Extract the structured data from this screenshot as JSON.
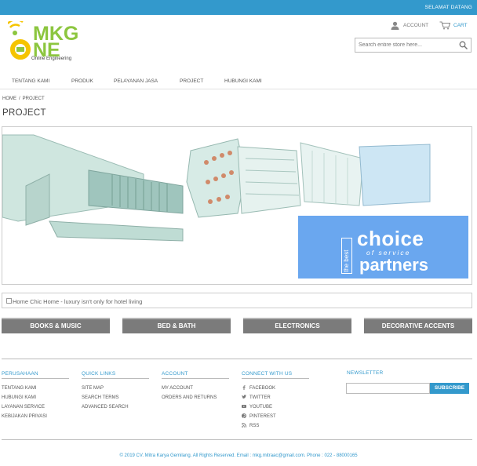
{
  "topbar": {
    "welcome": "SELAMAT DATANG"
  },
  "logo": {
    "line1": "MKG",
    "line2": "NE",
    "tagline": "Online Engineering"
  },
  "header": {
    "account_label": "ACCOUNT",
    "cart_label": "CART",
    "search_placeholder": "Search entire store here..."
  },
  "nav": {
    "items": [
      "TENTANG KAMI",
      "PRODUK",
      "PELAYANAN JASA",
      "PROJECT",
      "HUBUNGI KAMI"
    ]
  },
  "breadcrumb": {
    "home": "HOME",
    "separator": "/",
    "current": "PROJECT"
  },
  "page_title": "PROJECT",
  "banner": {
    "vertical_text": "the best",
    "headline_1": "choice",
    "subline": "of service",
    "headline_2": "partners"
  },
  "alt_image_text": "Home Chic Home - luxury isn't only for hotel living",
  "categories": [
    "BOOKS & MUSIC",
    "BED & BATH",
    "ELECTRONICS",
    "DECORATIVE ACCENTS"
  ],
  "footer": {
    "perusahaan": {
      "title": "PERUSAHAAN",
      "links": [
        "TENTANG KAMI",
        "HUBUNGI KAMI",
        "LAYANAN SERVICE",
        "KEBIJAKAN PRIVASI"
      ]
    },
    "quick_links": {
      "title": "QUICK LINKS",
      "links": [
        "SITE MAP",
        "SEARCH TERMS",
        "ADVANCED SEARCH"
      ]
    },
    "account": {
      "title": "ACCOUNT",
      "links": [
        "MY ACCOUNT",
        "ORDERS AND RETURNS"
      ]
    },
    "connect": {
      "title": "CONNECT WITH US",
      "links": [
        {
          "label": "FACEBOOK",
          "icon": "facebook-icon"
        },
        {
          "label": "TWITTER",
          "icon": "twitter-icon"
        },
        {
          "label": "YOUTUBE",
          "icon": "youtube-icon"
        },
        {
          "label": "PINTEREST",
          "icon": "pinterest-icon"
        },
        {
          "label": "RSS",
          "icon": "rss-icon"
        }
      ]
    },
    "newsletter": {
      "title": "NEWSLETTER",
      "button": "SUBSCRIBE"
    },
    "copyright": "© 2019 CV. Mitra Karya Gemilang. All Rights Reserved. Email : mkg.mitraac@gmail.com. Phone : 022 - 88000165"
  },
  "colors": {
    "accent": "#3399cc",
    "logo_green": "#8cc63f",
    "logo_yellow": "#f5c400",
    "category_bg": "#7b7b7b",
    "banner_blue": "#6aa7ef"
  }
}
